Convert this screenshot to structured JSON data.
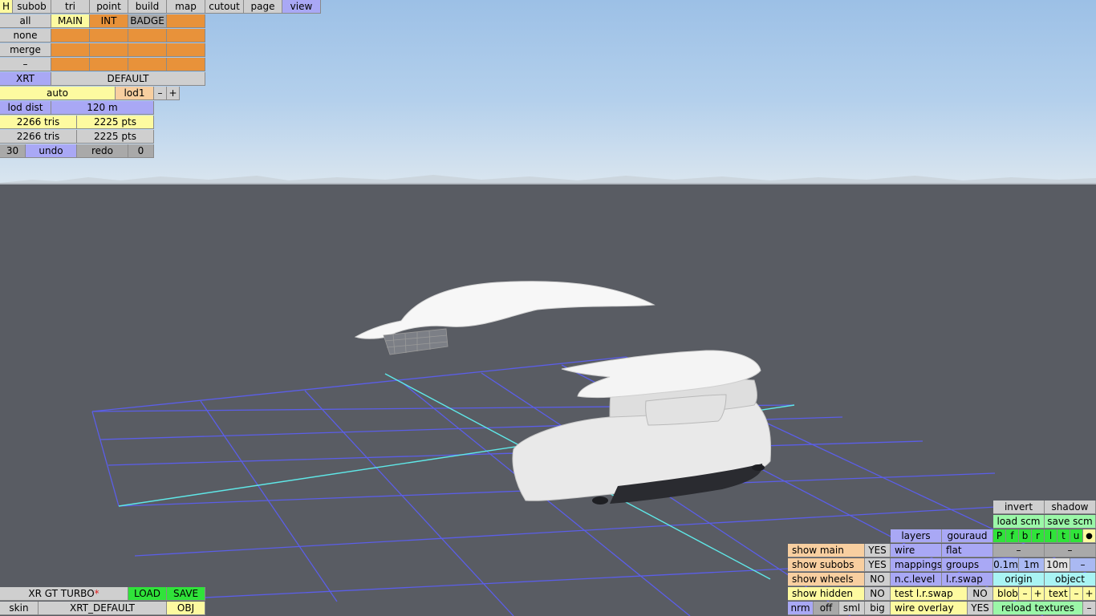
{
  "tabs": [
    {
      "id": "h",
      "label": "H"
    },
    {
      "id": "subob",
      "label": "subob"
    },
    {
      "id": "tri",
      "label": "tri"
    },
    {
      "id": "point",
      "label": "point"
    },
    {
      "id": "build",
      "label": "build"
    },
    {
      "id": "map",
      "label": "map"
    },
    {
      "id": "cutout",
      "label": "cutout"
    },
    {
      "id": "page",
      "label": "page"
    },
    {
      "id": "view",
      "label": "view"
    }
  ],
  "selection": {
    "all": "all",
    "none": "none",
    "merge": "merge",
    "dash": "–",
    "main": "MAIN",
    "int": "INT",
    "badge": "BADGE"
  },
  "skin_row": {
    "xrt": "XRT",
    "default": "DEFAULT"
  },
  "lod": {
    "auto": "auto",
    "level": "lod1",
    "minus": "–",
    "plus": "+",
    "dist_label": "lod dist",
    "dist_value": "120 m"
  },
  "stats": {
    "tris_selected": "2266 tris",
    "pts_selected": "2225 pts",
    "tris_total": "2266 tris",
    "pts_total": "2225 pts"
  },
  "history": {
    "count": "30",
    "undo": "undo",
    "redo": "redo",
    "redo_count": "0"
  },
  "file": {
    "car_name": "XR GT TURBO",
    "modified_mark": "*",
    "load": "LOAD",
    "save": "SAVE",
    "skin": "skin",
    "skin_name": "XRT_DEFAULT",
    "obj": "OBJ"
  },
  "view_panel": {
    "invert": "invert",
    "shadow": "shadow",
    "load_scm": "load scm",
    "save_scm": "save scm",
    "channels": [
      "P",
      "f",
      "b",
      "r",
      "l",
      "t",
      "u",
      "●"
    ],
    "layers": "layers",
    "gouraud": "gouraud",
    "wire": "wire",
    "flat": "flat",
    "mappings": "mappings",
    "groups": "groups",
    "nc_level": "n.c.level",
    "lr_swap": "l.r.swap",
    "test_lr_swap": "test l.r.swap",
    "test_lr_swap_val": "NO",
    "wire_overlay": "wire overlay",
    "wire_overlay_val": "YES",
    "show_main": "show main",
    "show_main_val": "YES",
    "show_subobs": "show subobs",
    "show_subobs_val": "YES",
    "show_wheels": "show wheels",
    "show_wheels_val": "NO",
    "show_hidden": "show hidden",
    "show_hidden_val": "NO",
    "dash": "–",
    "grid_01": "0.1m",
    "grid_1": "1m",
    "grid_10": "10m",
    "origin": "origin",
    "object": "object",
    "blob": "blob",
    "text": "text",
    "minus": "–",
    "plus": "+",
    "reload_textures": "reload textures",
    "nrm": "nrm",
    "off": "off",
    "sml": "sml",
    "big": "big"
  }
}
